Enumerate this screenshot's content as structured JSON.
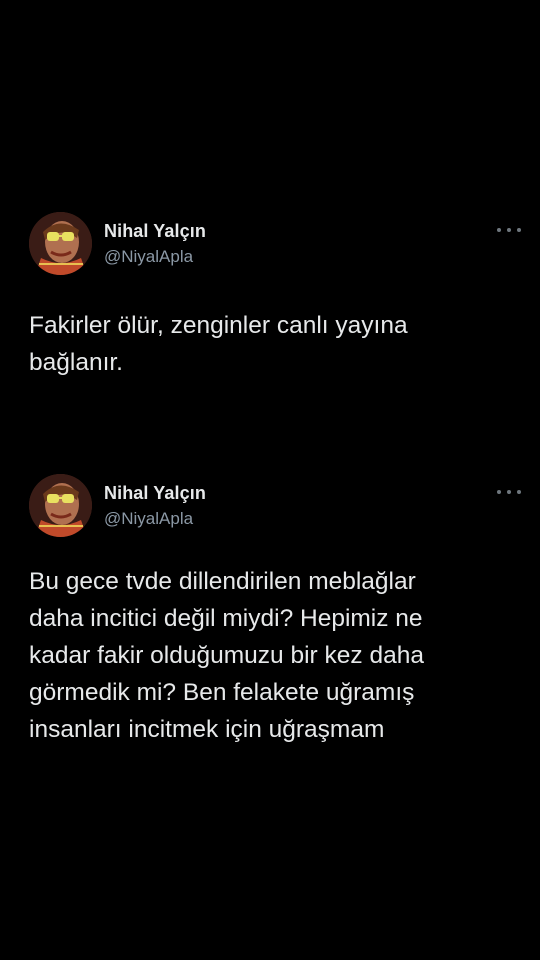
{
  "colors": {
    "background": "#000000",
    "text_primary": "#e7e9ea",
    "text_secondary": "#8b98a5",
    "icon": "#6e767d"
  },
  "tweets": [
    {
      "author_name": "Nihal Yalçın",
      "author_handle": "@NiyalApla",
      "avatar_icon": "profile-photo",
      "menu_icon": "more-options-icon",
      "text": "Fakirler ölür, zenginler canlı yayına\nbağlanır."
    },
    {
      "author_name": "Nihal Yalçın",
      "author_handle": "@NiyalApla",
      "avatar_icon": "profile-photo",
      "menu_icon": "more-options-icon",
      "text": "Bu gece tvde dillendirilen meblağlar\ndaha incitici değil miydi? Hepimiz ne\nkadar fakir olduğumuzu bir kez daha\ngörmedik mi? Ben felakete uğramış\ninsanları incitmek için uğraşmam"
    }
  ]
}
